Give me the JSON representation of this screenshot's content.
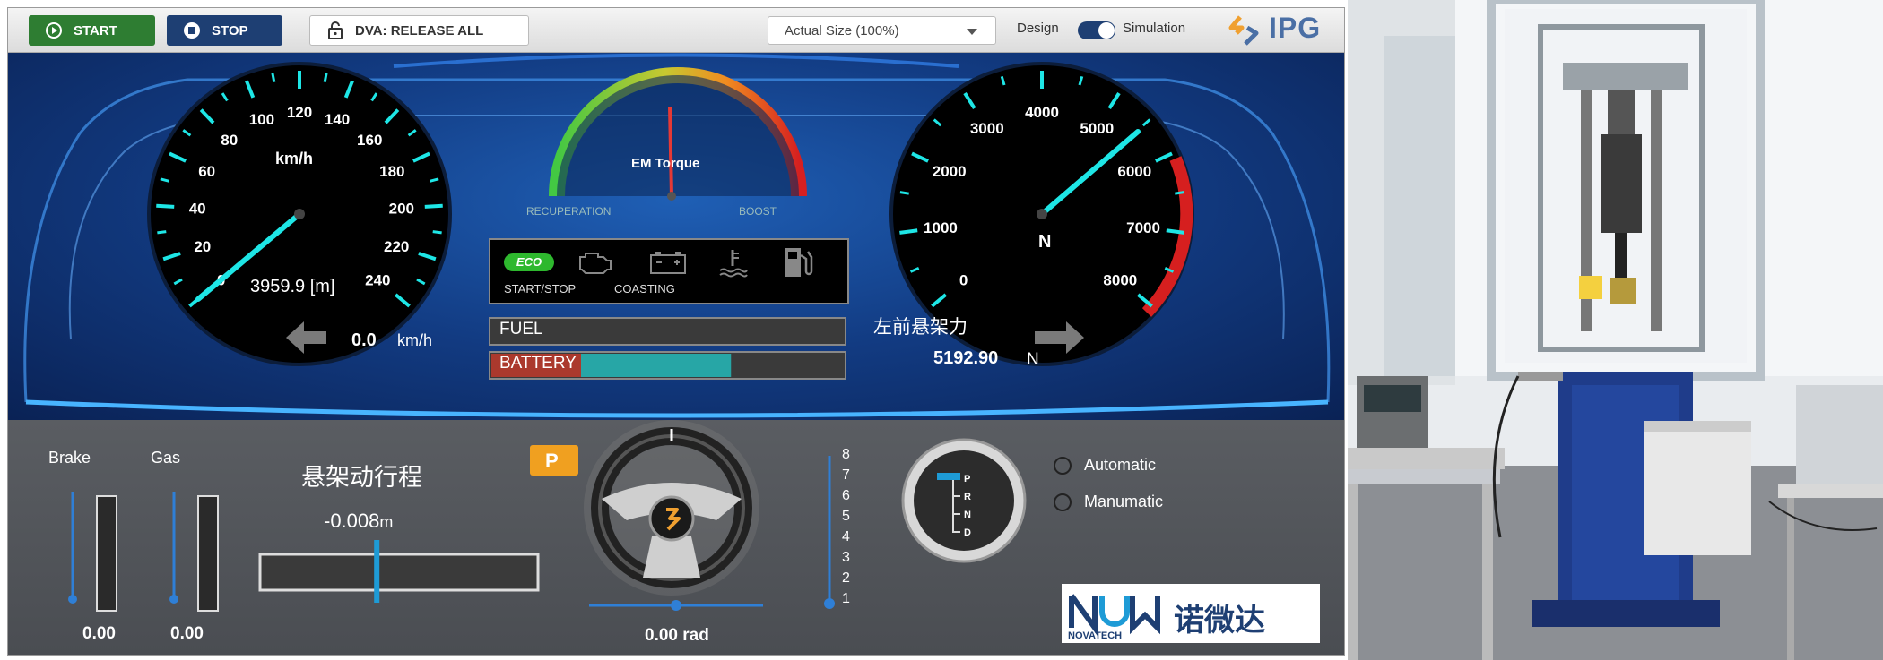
{
  "toolbar": {
    "start_label": "START",
    "stop_label": "STOP",
    "dva_label": "DVA: RELEASE ALL",
    "size_select_value": "Actual Size (100%)",
    "mode_design": "Design",
    "mode_simulation": "Simulation",
    "brand": "IPG"
  },
  "speedometer": {
    "unit": "km/h",
    "ticks": [
      "0",
      "20",
      "40",
      "60",
      "80",
      "100",
      "120",
      "140",
      "160",
      "180",
      "200",
      "220",
      "240"
    ],
    "distance": "3959.9 [m]",
    "speed_value": "0.0",
    "speed_unit": "km/h"
  },
  "torque": {
    "title": "EM Torque",
    "left_label": "RECUPERATION",
    "right_label": "BOOST"
  },
  "indicators": {
    "eco": "ECO",
    "start_stop": "START/STOP",
    "coasting": "COASTING"
  },
  "bars": {
    "fuel_label": "FUEL",
    "fuel_level": 0,
    "battery_label": "BATTERY",
    "battery_level": 0.68
  },
  "force_gauge": {
    "unit": "N",
    "ticks": [
      "0",
      "1000",
      "2000",
      "3000",
      "4000",
      "5000",
      "6000",
      "7000",
      "8000"
    ],
    "label_cn": "左前悬架力",
    "value": "5192.90",
    "value_unit": "N"
  },
  "pedals": {
    "brake_label": "Brake",
    "gas_label": "Gas",
    "brake_value": "0.00",
    "gas_value": "0.00",
    "brake_level": 0,
    "gas_level": 0
  },
  "suspension": {
    "title_cn": "悬架动行程",
    "value": "-0.008",
    "unit": "m",
    "level": 0.42
  },
  "parking": {
    "label": "P"
  },
  "steering": {
    "value": "0.00 rad"
  },
  "gear_scale": [
    "8",
    "7",
    "6",
    "5",
    "4",
    "3",
    "2",
    "1"
  ],
  "shifter": {
    "positions": [
      "P",
      "R",
      "N",
      "D"
    ],
    "selected": "P"
  },
  "transmission_modes": [
    "Automatic",
    "Manumatic"
  ],
  "novatech": {
    "logo_text": "NOVATECH",
    "cn_name": "诺微达"
  },
  "colors": {
    "accent_cyan": "#1ee6e6",
    "needle_red": "#e53935",
    "start_green": "#2e7d32",
    "stop_navy": "#1e3f73",
    "battery_teal": "#27a6a6"
  }
}
